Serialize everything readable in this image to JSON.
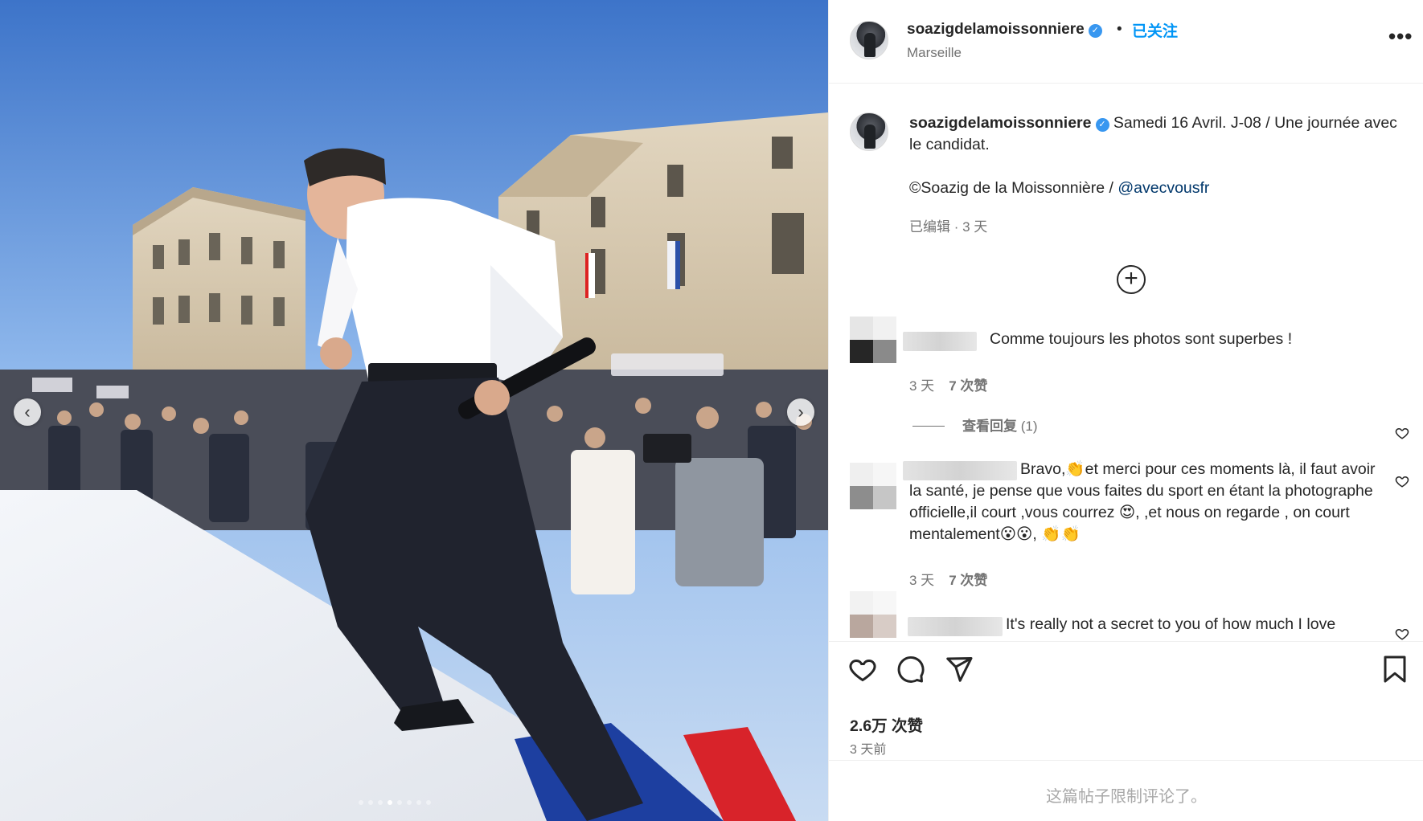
{
  "post": {
    "username": "soazigdelamoissonniere",
    "verified_mark": "✓",
    "separator": "•",
    "follow_status": "已关注",
    "location": "Marseille",
    "more_icon": "•••",
    "caption": {
      "line1": "Samedi 16 Avril. J-08 / Une journée avec le candidat.",
      "credit": "©Soazig de la Moissonnière / ",
      "mention": "@avecvousfr",
      "meta": "已编辑 · 3 天"
    },
    "load_more_icon": "+",
    "comments": [
      {
        "text": "Comme toujours les photos sont superbes !",
        "time": "3 天",
        "likes": "7 次赞",
        "replies_label": "查看回复",
        "replies_count": "(1)"
      },
      {
        "text": "Bravo,👏et merci pour ces moments là, il faut avoir la santé, je pense que vous faites du sport en étant la photographe officielle,il court ,vous courrez 😍, ,et nous on regarde , on court mentalement😮😮, 👏👏",
        "time": "3 天",
        "likes": "7 次赞"
      },
      {
        "text": "It's really not a secret to you of how much I love"
      }
    ],
    "likes_total": "2.6万 次赞",
    "posted_ago": "3 天前",
    "comments_disabled": "这篇帖子限制评论了。",
    "carousel": {
      "prev_icon": "‹",
      "next_icon": "›",
      "slide_count": 8,
      "active_slide": 3
    }
  },
  "colors": {
    "accent": "#0095f6",
    "mention": "#00376b",
    "verified": "#3897f0",
    "muted": "#737373"
  },
  "icons": [
    "heart-icon",
    "comment-icon",
    "share-icon",
    "bookmark-icon",
    "more-icon",
    "add-circle-icon",
    "verified-icon"
  ]
}
